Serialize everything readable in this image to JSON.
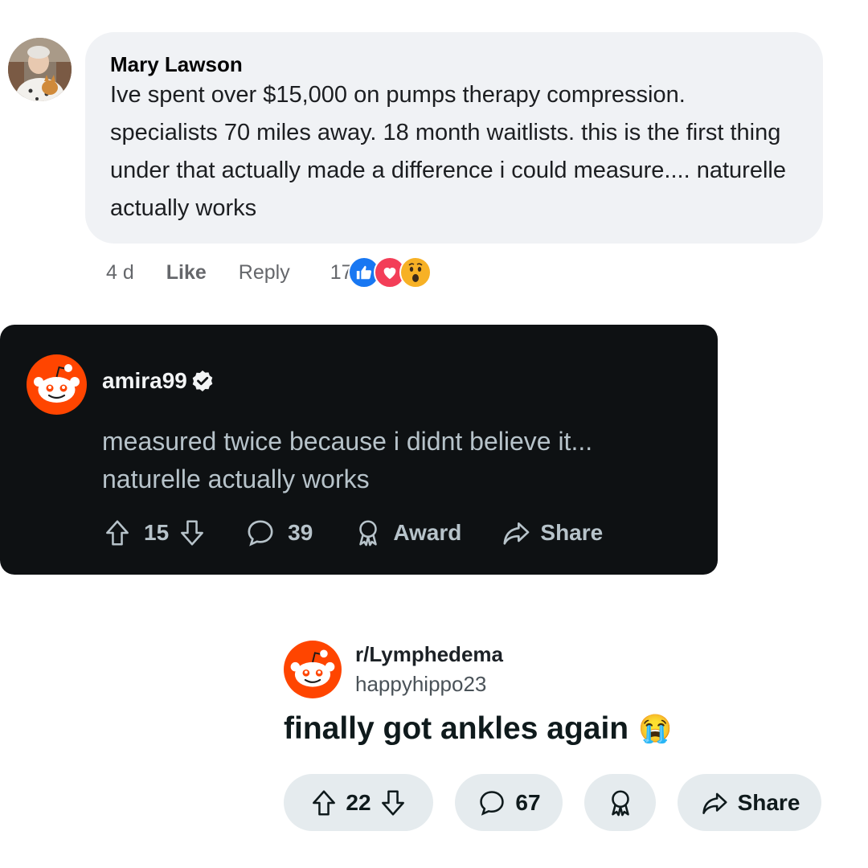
{
  "facebook_comment": {
    "author": "Mary Lawson",
    "text": "Ive spent over $15,000 on pumps therapy compression. specialists 70 miles away. 18 month waitlists. this is the first thing under that actually made a difference i could measure.... naturelle actually works",
    "time": "4 d",
    "like_label": "Like",
    "reply_label": "Reply",
    "reaction_count": "17",
    "reactions": [
      "like-icon",
      "heart-icon",
      "wow-icon"
    ],
    "colors": {
      "like": "#1877f2",
      "love": "#f33e58",
      "wow": "#f7b125"
    }
  },
  "reddit_comment": {
    "username": "amira99",
    "verified_icon": "verified-badge-icon",
    "text": "measured twice because i didnt believe it... naturelle actually works",
    "upvotes": "15",
    "comments": "39",
    "award_label": "Award",
    "share_label": "Share",
    "colors": {
      "background": "#0e1113",
      "avatar": "#ff4500"
    }
  },
  "reddit_post": {
    "subreddit": "r/Lymphedema",
    "username": "happyhippo23",
    "title": "finally got ankles again",
    "title_emoji": "😭",
    "upvotes": "22",
    "comments": "67",
    "share_label": "Share",
    "colors": {
      "pill": "#e5ebee",
      "avatar": "#ff4500"
    }
  }
}
